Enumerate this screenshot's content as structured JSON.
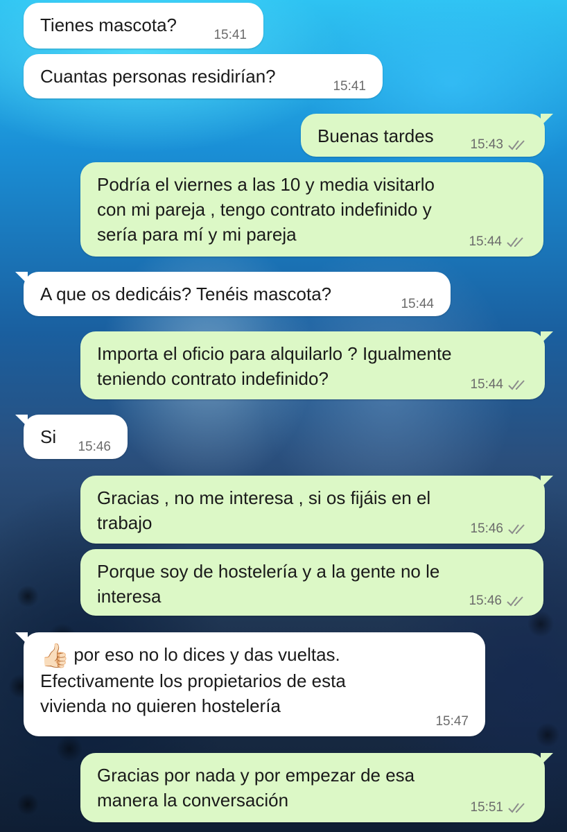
{
  "messages": [
    {
      "direction": "in",
      "text": "Tienes mascota?",
      "time": "15:41"
    },
    {
      "direction": "in",
      "text": "Cuantas personas residirían?",
      "time": "15:41"
    },
    {
      "direction": "out",
      "text": "Buenas tardes",
      "time": "15:43",
      "status": "read"
    },
    {
      "direction": "out",
      "lines": [
        "Podría el  viernes a las 10 y media visitarlo",
        "con mi pareja , tengo contrato indefinido y",
        "sería para mí y mi pareja"
      ],
      "time": "15:44",
      "status": "read"
    },
    {
      "direction": "in",
      "text": "A que os dedicáis? Tenéis mascota?",
      "time": "15:44"
    },
    {
      "direction": "out",
      "lines": [
        "Importa el oficio para alquilarlo ? Igualmente",
        "teniendo contrato indefinido?"
      ],
      "time": "15:44",
      "status": "read"
    },
    {
      "direction": "in",
      "text": "Si",
      "time": "15:46"
    },
    {
      "direction": "out",
      "lines": [
        "Gracias , no me interesa , si os fijáis en el",
        "trabajo"
      ],
      "time": "15:46",
      "status": "read"
    },
    {
      "direction": "out",
      "lines": [
        "Porque soy de hostelería y a la gente no le",
        "interesa"
      ],
      "time": "15:46",
      "status": "read"
    },
    {
      "direction": "in",
      "emoji": "👍🏻",
      "lines": [
        "por eso no lo dices y das vueltas.",
        "Efectivamente los propietarios de esta",
        "vivienda no quieren hostelería"
      ],
      "time": "15:47"
    },
    {
      "direction": "out",
      "lines": [
        "Gracias por nada y por empezar de esa",
        "manera la conversación"
      ],
      "time": "15:51",
      "status": "read"
    }
  ],
  "colors": {
    "incoming_bubble": "#ffffff",
    "outgoing_bubble": "#dcf8c6",
    "timestamp": "#6b6b6b",
    "read_check": "#8c8c8c"
  },
  "icons": {
    "read_receipt": "double-check-icon",
    "emoji": "thumbs-up-icon"
  }
}
